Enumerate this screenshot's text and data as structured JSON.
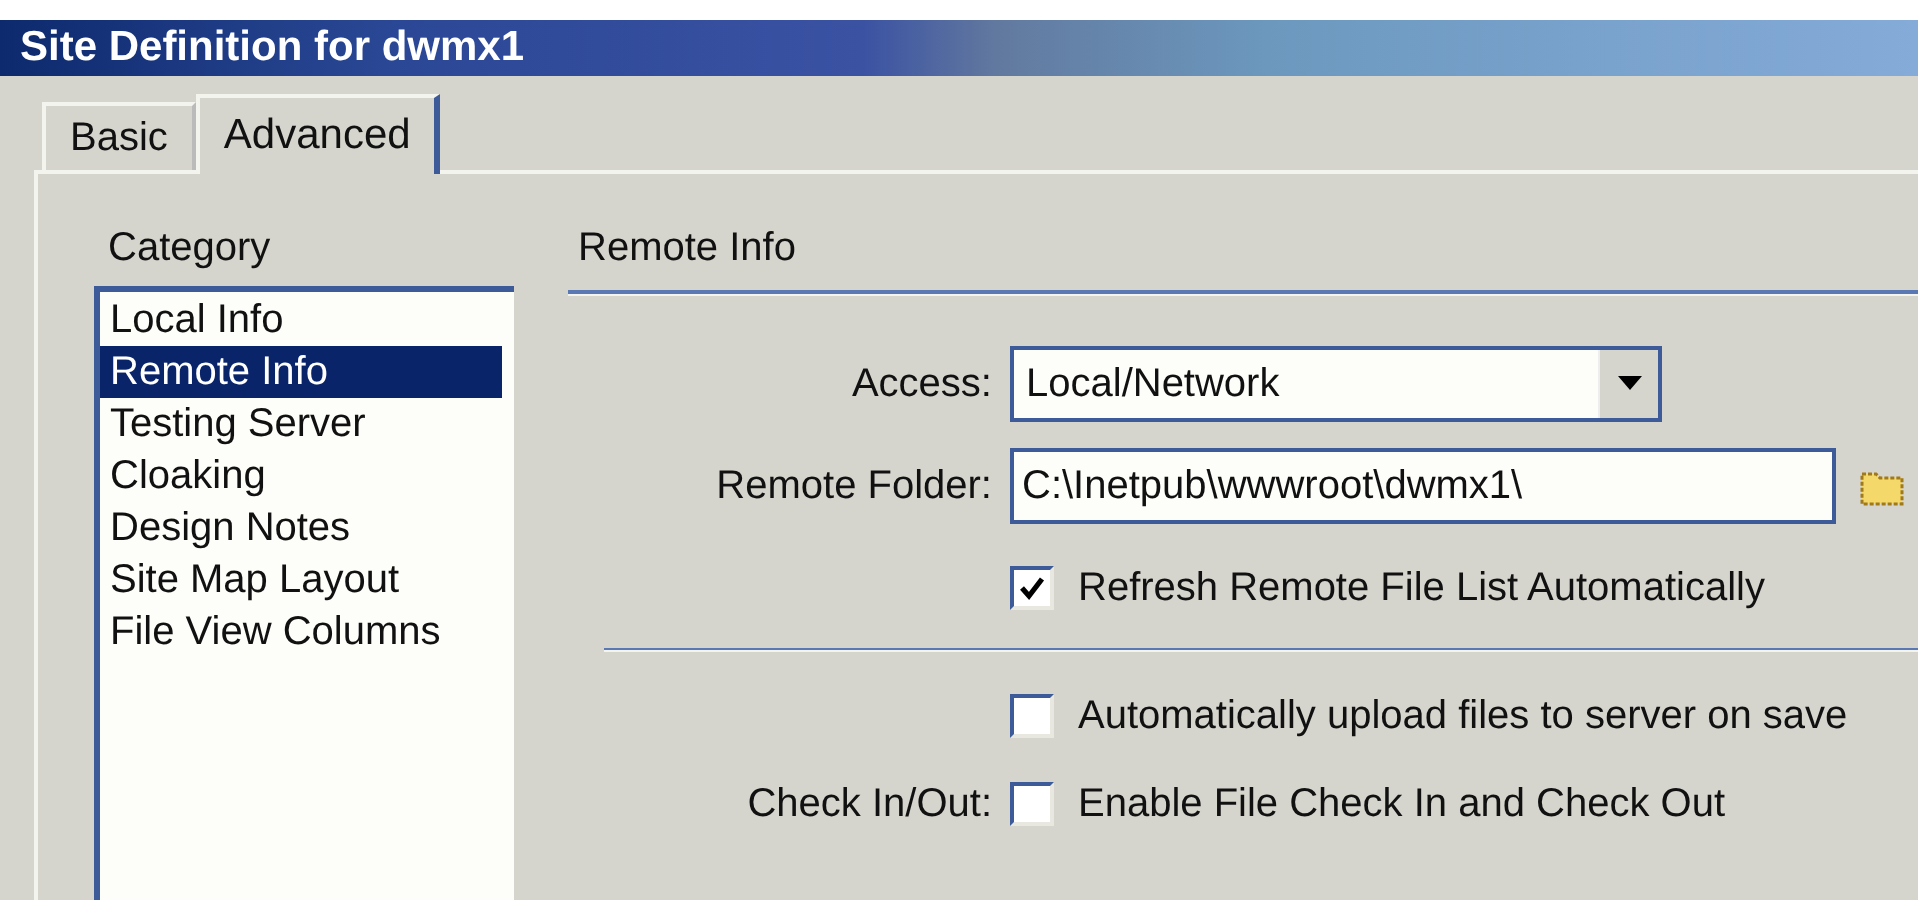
{
  "window": {
    "title": "Site Definition for dwmx1"
  },
  "tabs": [
    {
      "label": "Basic",
      "selected": false
    },
    {
      "label": "Advanced",
      "selected": true
    }
  ],
  "category": {
    "heading": "Category",
    "items": [
      {
        "label": "Local Info",
        "selected": false
      },
      {
        "label": "Remote Info",
        "selected": true
      },
      {
        "label": "Testing Server",
        "selected": false
      },
      {
        "label": "Cloaking",
        "selected": false
      },
      {
        "label": "Design Notes",
        "selected": false
      },
      {
        "label": "Site Map Layout",
        "selected": false
      },
      {
        "label": "File View Columns",
        "selected": false
      }
    ]
  },
  "section": {
    "title": "Remote Info",
    "access": {
      "label": "Access:",
      "value": "Local/Network"
    },
    "remote_folder": {
      "label": "Remote Folder:",
      "value": "C:\\Inetpub\\wwwroot\\dwmx1\\"
    },
    "refresh": {
      "label": "Refresh Remote File List Automatically",
      "checked": true
    },
    "auto_upload": {
      "label": "Automatically upload files to server on save",
      "checked": false
    },
    "check_in_out": {
      "caption": "Check In/Out:",
      "label": "Enable File Check In and Check Out",
      "checked": false
    }
  }
}
